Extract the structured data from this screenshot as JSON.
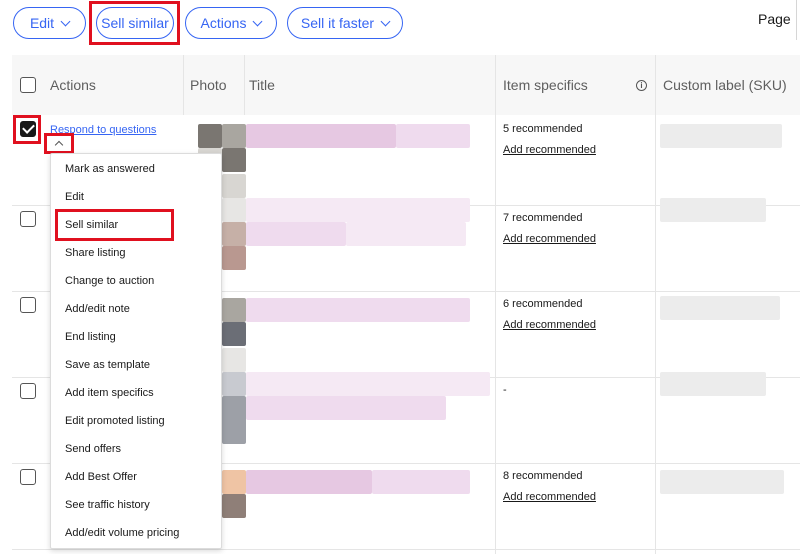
{
  "toolbar": {
    "edit_label": "Edit",
    "sell_similar_label": "Sell similar",
    "actions_label": "Actions",
    "sell_faster_label": "Sell it faster",
    "page_label": "Page"
  },
  "table": {
    "headers": {
      "actions": "Actions",
      "photo": "Photo",
      "title": "Title",
      "item_specifics": "Item specifics",
      "custom_label": "Custom label (SKU)"
    },
    "rows": [
      {
        "checked": true,
        "recommended": "5 recommended",
        "add_link": "Add recommended"
      },
      {
        "checked": false,
        "recommended": "7 recommended",
        "add_link": "Add recommended"
      },
      {
        "checked": false,
        "recommended": "6 recommended",
        "add_link": "Add recommended"
      },
      {
        "checked": false,
        "recommended": "-",
        "add_link": ""
      },
      {
        "checked": false,
        "recommended": "8 recommended",
        "add_link": "Add recommended"
      }
    ]
  },
  "row_actions": {
    "respond_link": "Respond to questions"
  },
  "menu": {
    "items": [
      "Mark as answered",
      "Edit",
      "Sell similar",
      "Share listing",
      "Change to auction",
      "Add/edit note",
      "End listing",
      "Save as template",
      "Add item specifics",
      "Edit promoted listing",
      "Send offers",
      "Add Best Offer",
      "See traffic history",
      "Add/edit volume pricing"
    ]
  },
  "icons": {
    "chevron": "chevron-down-icon",
    "caret": "chevron-up-icon",
    "info": "info-icon",
    "checkbox": "checkbox-icon"
  },
  "colors": {
    "accent": "#3665f3",
    "highlight": "#e0101f"
  }
}
